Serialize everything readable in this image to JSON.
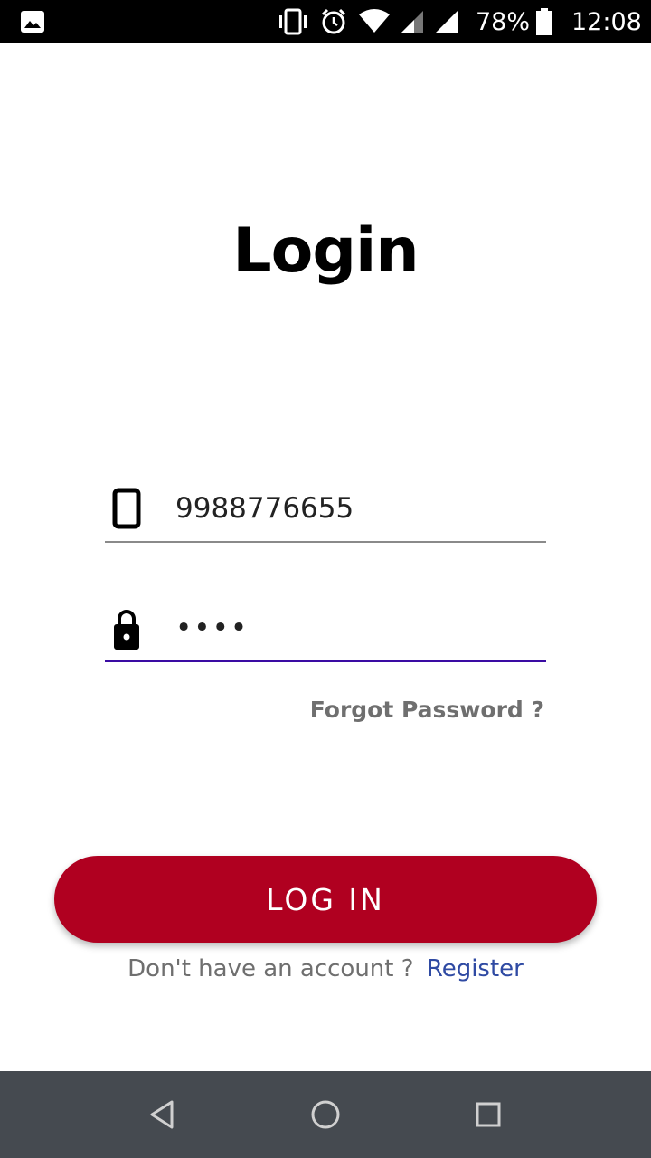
{
  "status_bar": {
    "battery": "78%",
    "time": "12:08",
    "icons": [
      "gallery-icon",
      "vibrate-icon",
      "alarm-icon",
      "wifi-icon",
      "signal-icon",
      "signal-icon",
      "battery-icon"
    ]
  },
  "title": "Login",
  "phone_field": {
    "icon": "phone-icon",
    "value": "9988776655"
  },
  "password_field": {
    "icon": "lock-icon",
    "value": "••••"
  },
  "forgot_password": "Forgot Password ?",
  "login_button": "LOG IN",
  "register": {
    "prompt": "Don't have an account ?",
    "link": "Register"
  },
  "nav_bar": {
    "icons": [
      "back-icon",
      "home-icon",
      "recents-icon"
    ]
  },
  "colors": {
    "primary": "#b00020",
    "focus_underline": "#3a0ca3",
    "link": "#2f4aa3",
    "nav_bar": "#454a50"
  }
}
